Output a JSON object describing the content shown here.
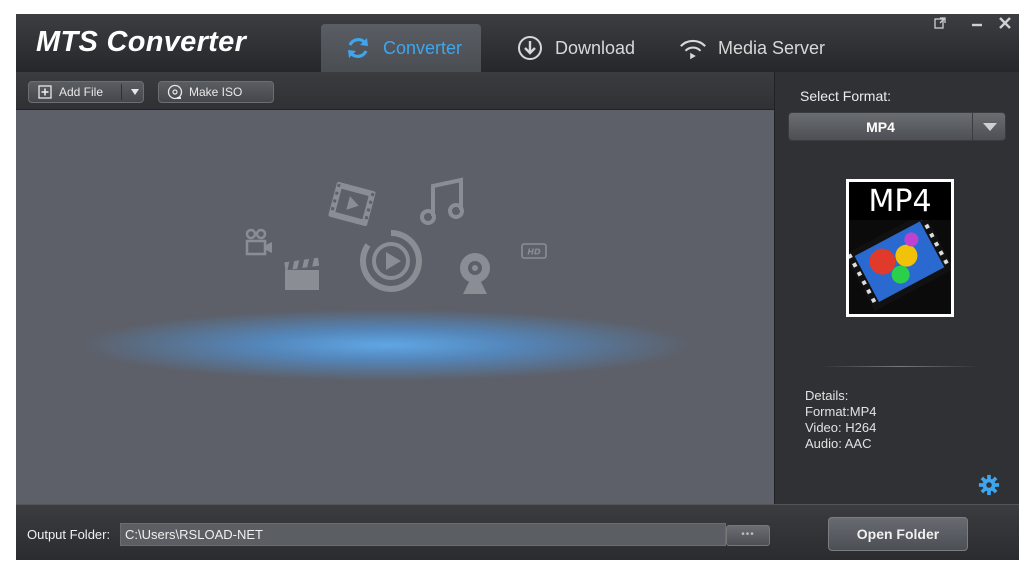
{
  "app": {
    "title": "MTS Converter"
  },
  "tabs": [
    {
      "label": "Converter",
      "icon": "refresh-icon",
      "active": true
    },
    {
      "label": "Download",
      "icon": "download-icon"
    },
    {
      "label": "Media Server",
      "icon": "wifi-icon"
    }
  ],
  "window_controls": {
    "popout": "popout-icon",
    "minimize": "minimize-icon",
    "close": "close-icon"
  },
  "toolbar": {
    "add_file_label": "Add File",
    "make_iso_label": "Make ISO"
  },
  "right_panel": {
    "select_format_label": "Select Format:",
    "selected_format": "MP4",
    "thumbnail_text": "MP4",
    "details": {
      "heading": "Details:",
      "format": "Format:MP4",
      "video": "Video: H264",
      "audio": "Audio: AAC"
    }
  },
  "bottom": {
    "output_label": "Output Folder:",
    "output_path": "C:\\Users\\RSLOAD-NET",
    "browse_label": "•••",
    "open_folder_label": "Open Folder"
  },
  "colors": {
    "accent": "#3ea6ef",
    "panel": "#5d6069",
    "chrome": "#2d2f33"
  }
}
